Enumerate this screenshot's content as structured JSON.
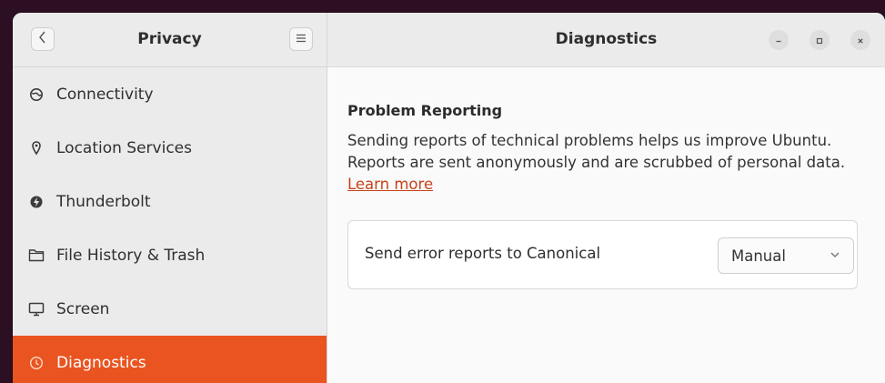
{
  "sidebar": {
    "title": "Privacy",
    "back_icon": "chevron-left-icon",
    "menu_icon": "hamburger-menu-icon",
    "items": [
      {
        "label": "Connectivity",
        "icon": "globe-icon"
      },
      {
        "label": "Location Services",
        "icon": "location-pin-icon"
      },
      {
        "label": "Thunderbolt",
        "icon": "thunderbolt-icon"
      },
      {
        "label": "File History & Trash",
        "icon": "folder-icon"
      },
      {
        "label": "Screen",
        "icon": "monitor-icon"
      },
      {
        "label": "Diagnostics",
        "icon": "diagnostics-icon",
        "active": true
      }
    ]
  },
  "header": {
    "title": "Diagnostics",
    "controls": [
      "minimize-icon",
      "maximize-icon",
      "close-icon"
    ]
  },
  "problem_reporting": {
    "title": "Problem Reporting",
    "description": "Sending reports of technical problems helps us improve Ubuntu. Reports are sent anonymously and are scrubbed of personal data.",
    "learn_more": "Learn more",
    "setting_label": "Send error reports to Canonical",
    "setting_value": "Manual"
  },
  "colors": {
    "accent": "#e95420",
    "link": "#c7431a"
  }
}
